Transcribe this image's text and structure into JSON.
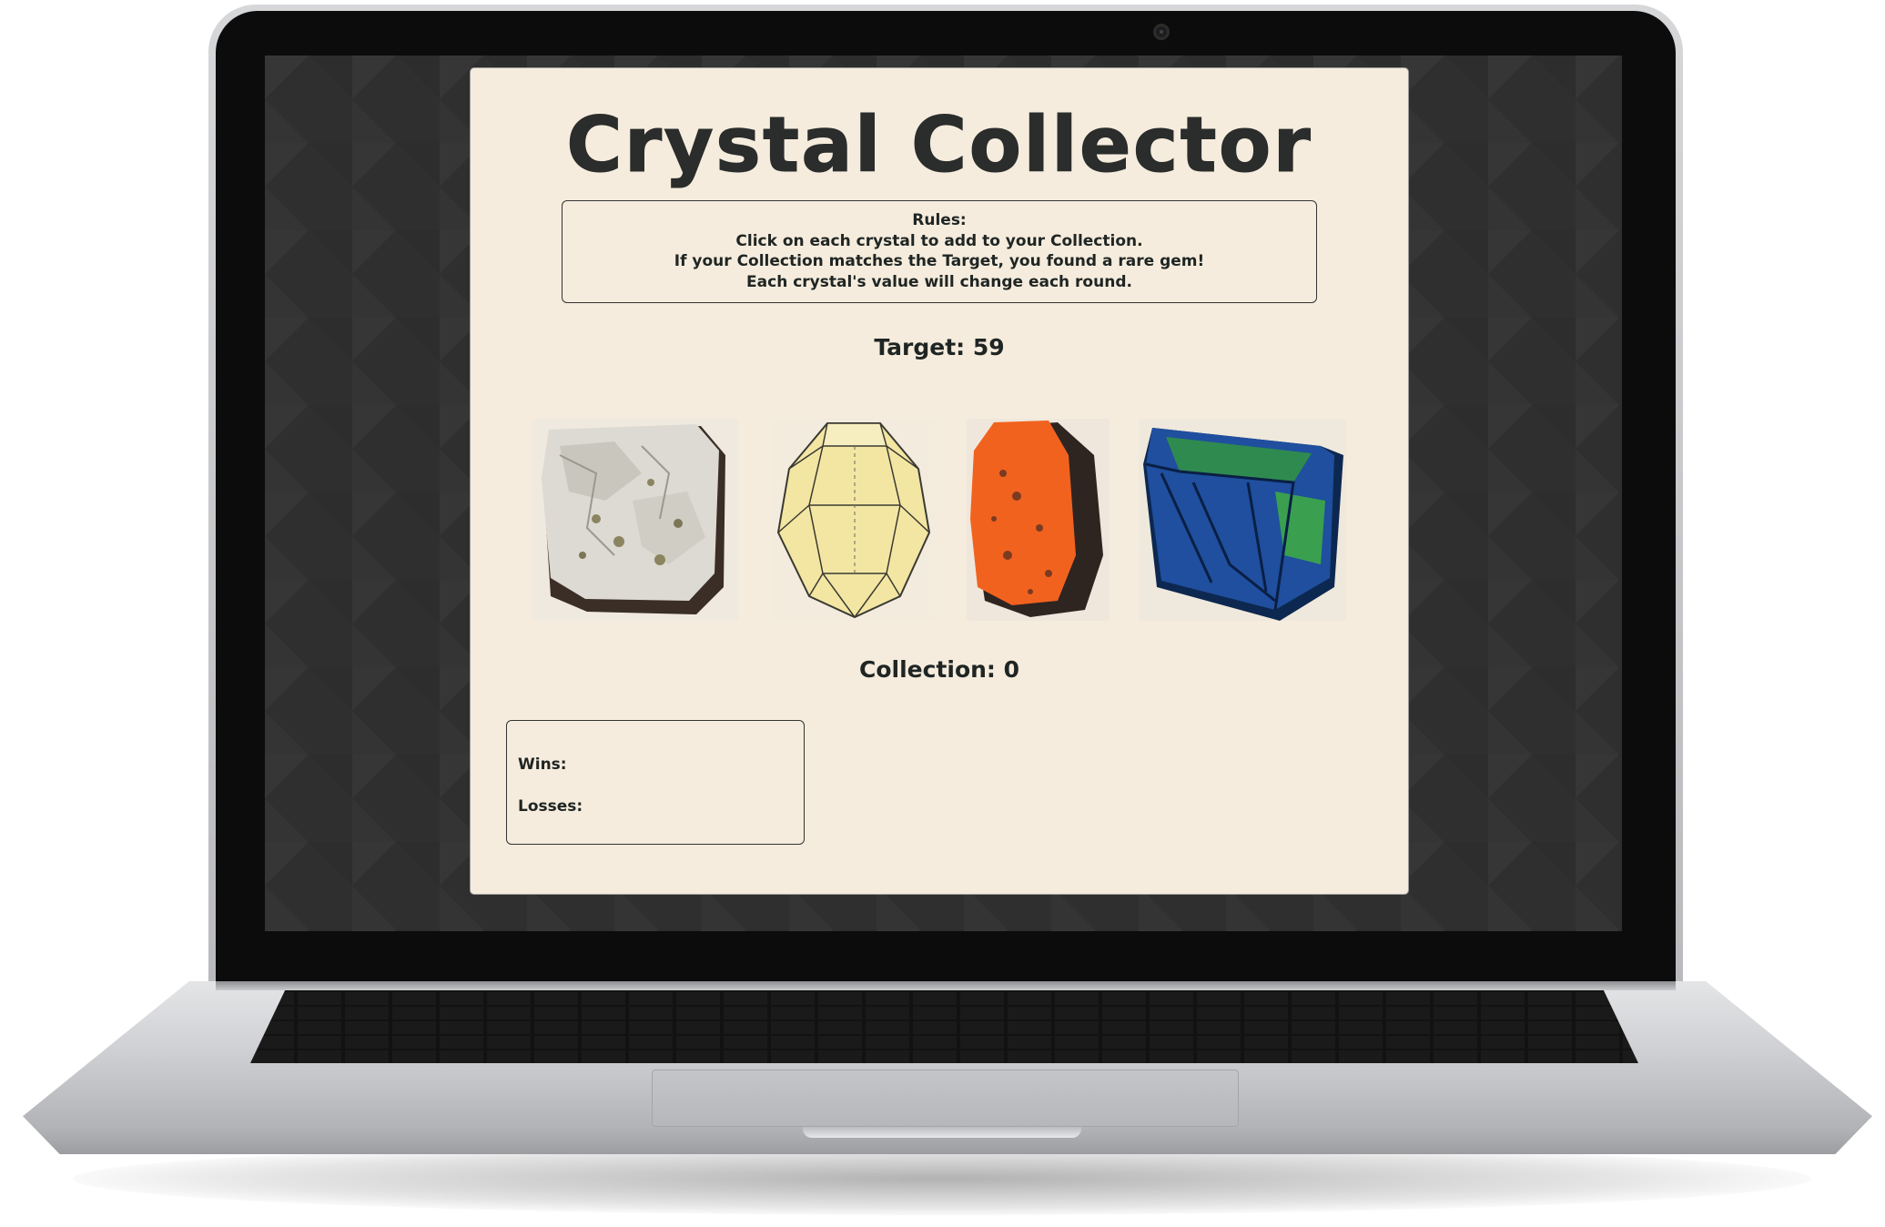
{
  "game": {
    "title": "Crystal Collector",
    "rules": {
      "heading": "Rules:",
      "line1": "Click on each crystal to add to your Collection.",
      "line2": "If your Collection matches the Target, you found a rare gem!",
      "line3": "Each crystal's value will change each round."
    },
    "target_label": "Target: 59",
    "collection_label": "Collection: 0",
    "crystals": [
      {
        "name": "white-crystal",
        "color": "#d9d7cc"
      },
      {
        "name": "yellow-crystal",
        "color": "#f3e6a3"
      },
      {
        "name": "orange-crystal",
        "color": "#f2621f"
      },
      {
        "name": "blue-crystal",
        "color": "#1f4f9e"
      }
    ],
    "wins_label": "Wins:",
    "losses_label": "Losses:"
  },
  "colors": {
    "card_background": "#f5ecdd",
    "text": "#1f2523",
    "screen_background": "#2f2f2f"
  }
}
